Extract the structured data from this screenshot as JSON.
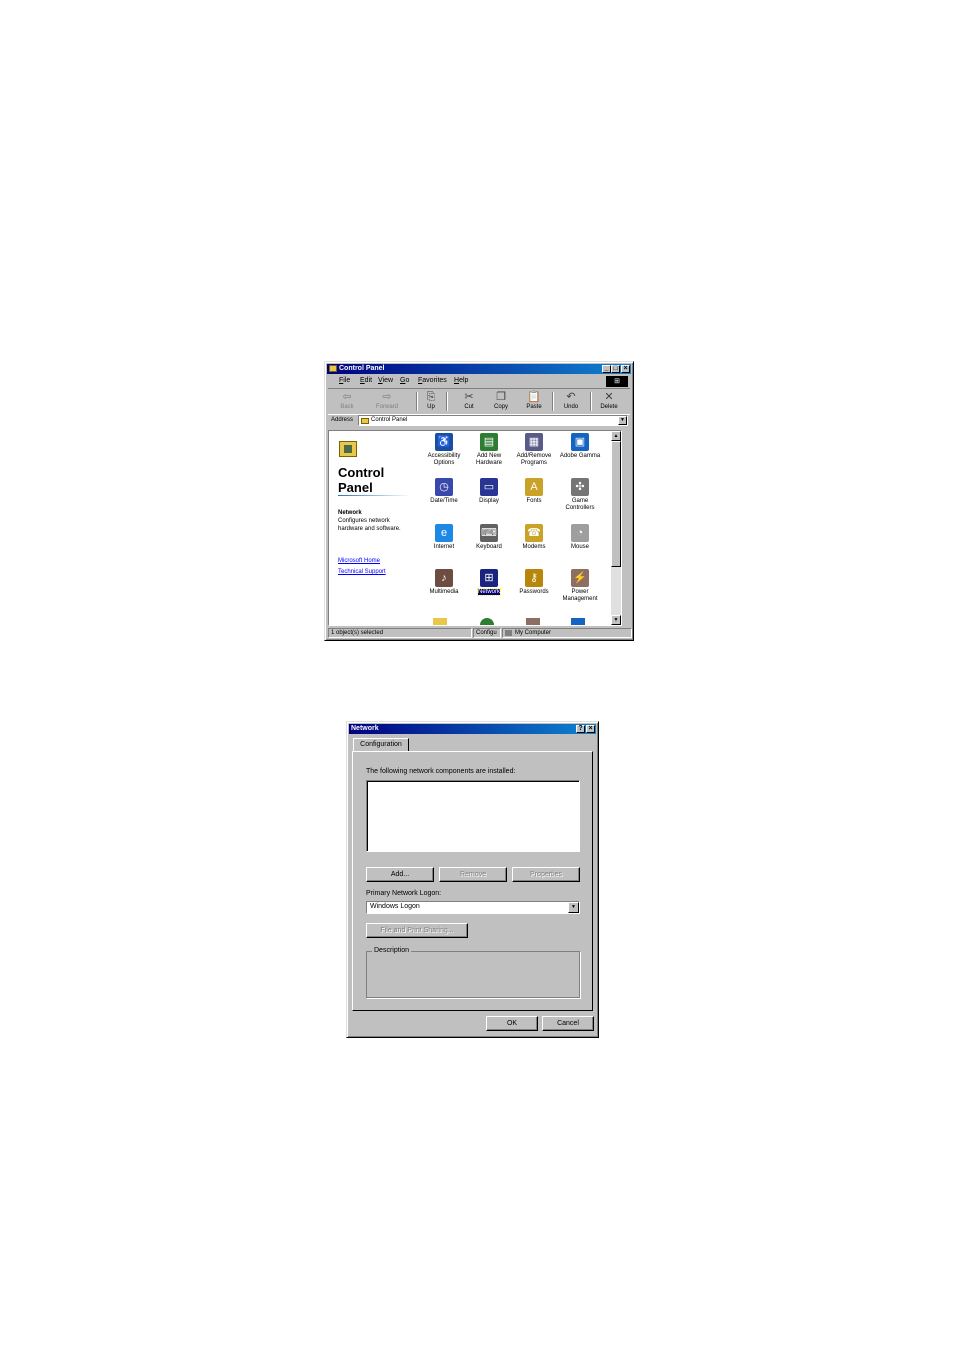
{
  "control_panel": {
    "title": "Control Panel",
    "window_buttons": [
      "_",
      "□",
      "×"
    ],
    "menu": [
      "File",
      "Edit",
      "View",
      "Go",
      "Favorites",
      "Help"
    ],
    "toolbar": [
      {
        "label": "Back",
        "icon": "back-arrow-icon",
        "disabled": true
      },
      {
        "label": "Forward",
        "icon": "forward-arrow-icon",
        "disabled": true
      },
      {
        "label": "Up",
        "icon": "up-folder-icon",
        "disabled": false
      },
      {
        "label": "Cut",
        "icon": "scissors-icon",
        "disabled": false
      },
      {
        "label": "Copy",
        "icon": "copy-icon",
        "disabled": false
      },
      {
        "label": "Paste",
        "icon": "paste-icon",
        "disabled": false
      },
      {
        "label": "Undo",
        "icon": "undo-icon",
        "disabled": false
      },
      {
        "label": "Delete",
        "icon": "delete-x-icon",
        "disabled": false
      }
    ],
    "address_label": "Address",
    "address_value": "Control Panel",
    "left_pane": {
      "heading": "Control Panel",
      "selected_name": "Network",
      "selected_desc": "Configures network hardware and software.",
      "links": [
        "Microsoft Home",
        "Technical Support"
      ]
    },
    "icons": [
      {
        "label": "Accessibility Options",
        "color": "#1a4fa0",
        "glyph": "♿"
      },
      {
        "label": "Add New Hardware",
        "color": "#2e7d32",
        "glyph": "▤"
      },
      {
        "label": "Add/Remove Programs",
        "color": "#5a5a8a",
        "glyph": "▦"
      },
      {
        "label": "Adobe Gamma",
        "color": "#1565c0",
        "glyph": "▣"
      },
      {
        "label": "Date/Time",
        "color": "#3949ab",
        "glyph": "◷"
      },
      {
        "label": "Display",
        "color": "#283593",
        "glyph": "▭"
      },
      {
        "label": "Fonts",
        "color": "#c9a227",
        "glyph": "A"
      },
      {
        "label": "Game Controllers",
        "color": "#757575",
        "glyph": "✣"
      },
      {
        "label": "Internet",
        "color": "#1e88e5",
        "glyph": "e"
      },
      {
        "label": "Keyboard",
        "color": "#616161",
        "glyph": "⌨"
      },
      {
        "label": "Modems",
        "color": "#c9a227",
        "glyph": "☎"
      },
      {
        "label": "Mouse",
        "color": "#9e9e9e",
        "glyph": "◔"
      },
      {
        "label": "Multimedia",
        "color": "#6d4c41",
        "glyph": "♪"
      },
      {
        "label": "Network",
        "color": "#1a237e",
        "glyph": "⊞",
        "selected": true
      },
      {
        "label": "Passwords",
        "color": "#b8860b",
        "glyph": "⚷"
      },
      {
        "label": "Power Management",
        "color": "#8d6e63",
        "glyph": "⚡"
      }
    ],
    "status": {
      "left": "1 object(s) selected",
      "mid": "Configu",
      "right": "My Computer"
    }
  },
  "network_dialog": {
    "title": "Network",
    "title_buttons": [
      "?",
      "×"
    ],
    "tab": "Configuration",
    "components_label": "The following network components are installed:",
    "buttons": {
      "add": "Add...",
      "remove": "Remove",
      "properties": "Properties"
    },
    "primary_logon_label": "Primary Network Logon:",
    "primary_logon_value": "Windows Logon",
    "file_print_sharing": "File and Print Sharing...",
    "description_label": "Description",
    "ok": "OK",
    "cancel": "Cancel"
  }
}
